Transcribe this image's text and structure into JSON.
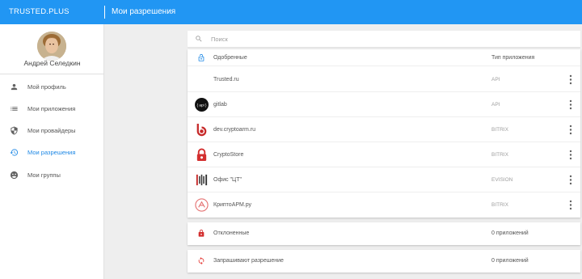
{
  "header": {
    "brand": "TRUSTED.PLUS",
    "title": "Мои разрешения",
    "accent_color": "#2196f3"
  },
  "user": {
    "name": "Андрей Селедкин"
  },
  "sidebar": {
    "items": [
      {
        "label": "Мой профиль",
        "icon": "person-icon",
        "active": false
      },
      {
        "label": "Мои приложения",
        "icon": "list-icon",
        "active": false
      },
      {
        "label": "Мои провайдеры",
        "icon": "shield-icon",
        "active": false
      },
      {
        "label": "Мои разрешения",
        "icon": "history-icon",
        "active": true
      },
      {
        "label": "Мои группы",
        "icon": "group-icon",
        "active": false
      }
    ]
  },
  "search": {
    "placeholder": "Поиск",
    "value": ""
  },
  "approved": {
    "title": "Одобренные",
    "type_header": "Тип приложения",
    "rows": [
      {
        "name": "Trusted.ru",
        "type": "API",
        "logo": "none"
      },
      {
        "name": "gitlab",
        "type": "API",
        "logo": "api-badge-icon"
      },
      {
        "name": "dev.cryptoarm.ru",
        "type": "BITRIX",
        "logo": "bitrix-logo-icon"
      },
      {
        "name": "CryptoStore",
        "type": "BITRIX",
        "logo": "cryptostore-lock-icon"
      },
      {
        "name": "Офис \"ЦТ\"",
        "type": "EVISION",
        "logo": "office-ct-icon"
      },
      {
        "name": "КриптоАРМ.ру",
        "type": "BITRIX",
        "logo": "cryptoarm-icon"
      }
    ]
  },
  "rejected": {
    "label": "Отклоненные",
    "count": "0 приложений",
    "icon": "lock-icon"
  },
  "requesting": {
    "label": "Запрашивают разрешение",
    "count": "0 приложений",
    "icon": "sync-icon"
  }
}
